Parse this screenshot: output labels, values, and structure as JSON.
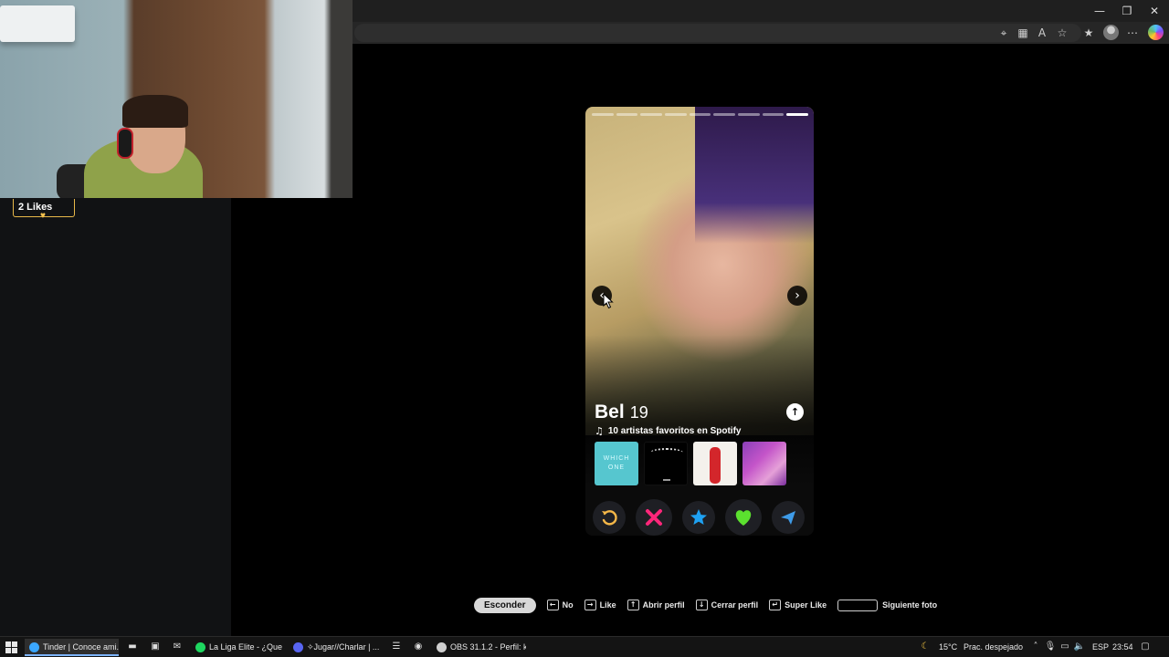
{
  "window": {
    "controls": {
      "minimize": "—",
      "restore": "❐",
      "close": "✕"
    }
  },
  "toolbar_icons": [
    "location-icon",
    "reader-icon",
    "read-aloud-icon",
    "favorite-star-icon",
    "favorites-icon",
    "profile-icon",
    "more-icon",
    "copilot-icon"
  ],
  "sidebar": {
    "likes_badge": "2 Likes"
  },
  "profile": {
    "name": "Bel",
    "age": "19",
    "spotify_text": "10 artistas favoritos en Spotify",
    "photo_count": 9,
    "active_photo": 9,
    "albums": [
      {
        "cover_text": "WHICH ONE"
      },
      {
        "cover_text": ""
      },
      {
        "cover_text": ""
      },
      {
        "cover_text": ""
      }
    ]
  },
  "actions": {
    "rewind_color": "#f5b748",
    "nope_color": "#fd267a",
    "superlike_color": "#1ea1f2",
    "like_color": "#5be02f",
    "boost_color": "#3e9be8"
  },
  "shortcuts": {
    "hide_label": "Esconder",
    "items": [
      {
        "key": "←",
        "label": "No"
      },
      {
        "key": "→",
        "label": "Like"
      },
      {
        "key": "↑",
        "label": "Abrir perfil"
      },
      {
        "key": "↓",
        "label": "Cerrar perfil"
      },
      {
        "key": "↵",
        "label": "Super Like"
      }
    ],
    "next_photo_label": "Siguiente foto"
  },
  "taskbar": {
    "apps": [
      {
        "label": "Tinder | Conoce ami...",
        "color": "#3ba7ff"
      },
      {
        "label": "La Liga Elite - ¿Que S...",
        "color": "#1ed760"
      },
      {
        "label": "✧Jugar//Charlar | ...",
        "color": "#5865f2"
      },
      {
        "label": "OBS 31.1.2 - Perfil: ki...",
        "color": "#cfcfcf"
      }
    ],
    "weather_temp": "15°C",
    "weather_text": "Prac. despejado",
    "language": "ESP",
    "time": "23:54"
  }
}
